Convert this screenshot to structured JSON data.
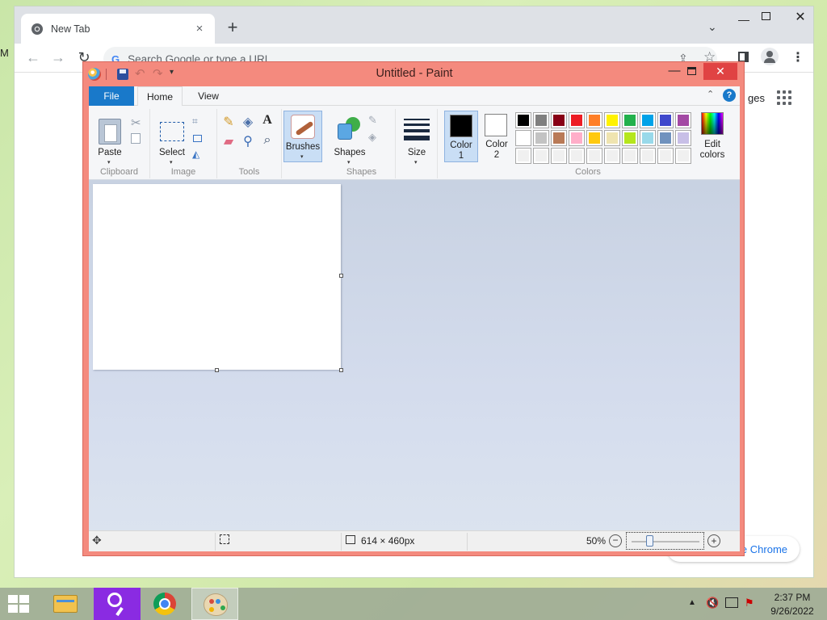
{
  "chrome": {
    "tab_title": "New Tab",
    "tab_close_icon": "×",
    "new_tab_icon": "+",
    "tab_search_icon": "⌄",
    "min_icon": "—",
    "close_icon": "✕",
    "back_icon": "←",
    "forward_icon": "→",
    "reload_icon": "↻",
    "google_icon": "G",
    "omnibox_placeholder": "Search Google or type a URL",
    "share_icon": "⇪",
    "star_icon": "☆",
    "menu_icon": "⋮",
    "images_link_partial": "ges",
    "customize_partial": "e Chrome",
    "edge_letter": "M"
  },
  "paint": {
    "title": "Untitled - Paint",
    "undo_icon": "↶",
    "redo_icon": "↷",
    "qa_more_icon": "▾",
    "min_icon": "—",
    "close_icon": "✕",
    "tabs": {
      "file": "File",
      "home": "Home",
      "view": "View"
    },
    "collapse_icon": "⌃",
    "help_icon": "?",
    "groups": {
      "clipboard": "Clipboard",
      "image": "Image",
      "tools": "Tools",
      "shapes": "Shapes",
      "colors": "Colors"
    },
    "buttons": {
      "paste": "Paste",
      "select": "Select",
      "brushes": "Brushes",
      "shapes": "Shapes",
      "size": "Size",
      "color1": "Color\n1",
      "color2": "Color\n2",
      "edit_colors": "Edit\ncolors"
    },
    "icons": {
      "cut": "✂",
      "crop": "⌗",
      "rotate": "◭",
      "pencil": "✎",
      "fill": "◈",
      "text": "A",
      "eraser": "▰",
      "picker": "⚲",
      "magnifier": "⌕",
      "outline": "✎",
      "shape_fill": "◈",
      "dropdown": "▾",
      "move": "✥"
    },
    "colors": {
      "color1": "#000000",
      "color2": "#ffffff",
      "palette_row1": [
        "#000000",
        "#7f7f7f",
        "#880015",
        "#ed1c24",
        "#ff7f27",
        "#fff200",
        "#22b14c",
        "#00a2e8",
        "#3f48cc",
        "#a349a4"
      ],
      "palette_row2": [
        "#ffffff",
        "#c3c3c3",
        "#b97a57",
        "#ffaec9",
        "#ffc90e",
        "#efe4b0",
        "#b5e61d",
        "#99d9ea",
        "#7092be",
        "#c8bfe7"
      ],
      "palette_row3": [
        "#f0f0f0",
        "#f0f0f0",
        "#f0f0f0",
        "#f0f0f0",
        "#f0f0f0",
        "#f0f0f0",
        "#f0f0f0",
        "#f0f0f0",
        "#f0f0f0",
        "#f0f0f0"
      ]
    },
    "status": {
      "image_size": "614 × 460px",
      "zoom": "50%",
      "zoom_out": "−",
      "zoom_in": "+",
      "zoom_level": 0.5
    }
  },
  "taskbar": {
    "tray_up_icon": "▲",
    "volume_icon": "🔇",
    "flag_icon": "⚑",
    "time": "2:37 PM",
    "date": "9/26/2022"
  }
}
